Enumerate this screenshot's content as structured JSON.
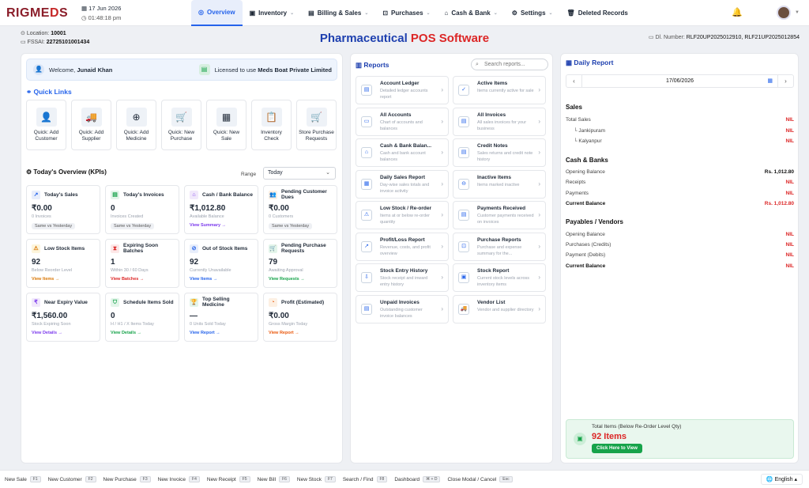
{
  "brand": {
    "logo_a": "RIGME",
    "logo_rx": "D",
    "logo_b": "S"
  },
  "header": {
    "date": "17 Jun 2026",
    "time": "01:48:18 pm",
    "bell_icon": "bell-icon",
    "user_icon": "user-avatar"
  },
  "nav": [
    {
      "label": "Overview",
      "icon": "◎",
      "active": true,
      "dropdown": false
    },
    {
      "label": "Inventory",
      "icon": "▣",
      "dropdown": true
    },
    {
      "label": "Billing & Sales",
      "icon": "▤",
      "dropdown": true
    },
    {
      "label": "Purchases",
      "icon": "⊡",
      "dropdown": true
    },
    {
      "label": "Cash & Bank",
      "icon": "⌂",
      "dropdown": true
    },
    {
      "label": "Settings",
      "icon": "⚙",
      "dropdown": true
    },
    {
      "label": "Deleted Records",
      "icon": "🗑",
      "dropdown": false
    }
  ],
  "location": {
    "location_label": "Location:",
    "location_value": "10001",
    "fssai_label": "FSSAI:",
    "fssai_value": "22725101001434"
  },
  "title": {
    "part1": "Pharmaceutical",
    "part2": "POS Software"
  },
  "dl": {
    "label": "Dl. Number:",
    "value": "RLF20UP2025012910, RLF21UP2025012854"
  },
  "welcome": {
    "prefix": "Welcome,",
    "name": "Junaid Khan",
    "licensed_prefix": "Licensed to use",
    "company": "Meds Boat Private Limited"
  },
  "quick_links": {
    "title": "Quick Links",
    "items": [
      {
        "label": "Quick: Add Customer",
        "icon": "👤",
        "name": "customer-icon"
      },
      {
        "label": "Quick: Add Supplier",
        "icon": "🚚",
        "name": "truck-icon"
      },
      {
        "label": "Quick: Add Medicine",
        "icon": "⊕",
        "name": "medicine-icon"
      },
      {
        "label": "Quick: New Purchase",
        "icon": "🛒",
        "name": "cart-icon"
      },
      {
        "label": "Quick: New Sale",
        "icon": "▦",
        "name": "sale-icon"
      },
      {
        "label": "Inventory Check",
        "icon": "📋",
        "name": "clipboard-icon"
      },
      {
        "label": "Store Purchase Requests",
        "icon": "🛒",
        "name": "store-cart-icon"
      }
    ]
  },
  "kpi": {
    "title": "Today's Overview (KPIs)",
    "range_label": "Range",
    "range_value": "Today",
    "cards": [
      {
        "title": "Today's Sales",
        "value": "₹0.00",
        "sub": "0 Invoices",
        "badge": "Same vs Yesterday",
        "link": "",
        "icon": "↗",
        "icon_bg": "#e8eefb",
        "icon_fg": "#2563eb",
        "link_color": "#2563eb"
      },
      {
        "title": "Today's Invoices",
        "value": "0",
        "sub": "Invoices Created",
        "badge": "Same vs Yesterday",
        "link": "",
        "icon": "▤",
        "icon_bg": "#e3f5ea",
        "icon_fg": "#16a34a",
        "link_color": "#16a34a"
      },
      {
        "title": "Cash / Bank Balance",
        "value": "₹1,012.80",
        "sub": "Available Balance",
        "badge": "",
        "link": "View Summary →",
        "icon": "⌂",
        "icon_bg": "#f1e8fb",
        "icon_fg": "#7c3aed",
        "link_color": "#7c3aed"
      },
      {
        "title": "Pending Customer Dues",
        "value": "₹0.00",
        "sub": "0 Customers",
        "badge": "Same vs Yesterday",
        "link": "",
        "icon": "👥",
        "icon_bg": "#fdf0e3",
        "icon_fg": "#ea580c",
        "link_color": "#ea580c"
      },
      {
        "title": "Low Stock Items",
        "value": "92",
        "sub": "Below Reorder Level",
        "badge": "",
        "link": "View Items →",
        "icon": "⚠",
        "icon_bg": "#fdf5dc",
        "icon_fg": "#d97706",
        "link_color": "#d97706"
      },
      {
        "title": "Expiring Soon Batches",
        "value": "1",
        "sub": "Within 30 / 60 Days",
        "badge": "",
        "link": "View Batches →",
        "icon": "⧗",
        "icon_bg": "#fde8e8",
        "icon_fg": "#dc2626",
        "link_color": "#dc2626"
      },
      {
        "title": "Out of Stock Items",
        "value": "92",
        "sub": "Currently Unavailable",
        "badge": "",
        "link": "View Items →",
        "icon": "⊘",
        "icon_bg": "#e8eefb",
        "icon_fg": "#2563eb",
        "link_color": "#2563eb"
      },
      {
        "title": "Pending Purchase Requests",
        "value": "79",
        "sub": "Awaiting Approval",
        "badge": "",
        "link": "View Requests →",
        "icon": "🛒",
        "icon_bg": "#e3f5ea",
        "icon_fg": "#16a34a",
        "link_color": "#16a34a"
      },
      {
        "title": "Near Expiry Value",
        "value": "₹1,560.00",
        "sub": "Stock Expiring Soon",
        "badge": "",
        "link": "View Details →",
        "icon": "₹",
        "icon_bg": "#f1e8fb",
        "icon_fg": "#7c3aed",
        "link_color": "#7c3aed"
      },
      {
        "title": "Schedule Items Sold",
        "value": "0",
        "sub": "H / H1 / X Items Today",
        "badge": "",
        "link": "View Details →",
        "icon": "⛉",
        "icon_bg": "#e3f5ea",
        "icon_fg": "#16a34a",
        "link_color": "#16a34a"
      },
      {
        "title": "Top Selling Medicine",
        "value": "—",
        "sub": "0 Units Sold Today",
        "badge": "",
        "link": "View Report →",
        "icon": "🏆",
        "icon_bg": "#e3f5ea",
        "icon_fg": "#16a34a",
        "link_color": "#2563eb"
      },
      {
        "title": "Profit (Estimated)",
        "value": "₹0.00",
        "sub": "Gross Margin Today",
        "badge": "",
        "link": "View Report →",
        "icon": "◔",
        "icon_bg": "#fdf0e3",
        "icon_fg": "#ea580c",
        "link_color": "#ea580c"
      }
    ]
  },
  "reports": {
    "title": "Reports",
    "search_placeholder": "Search reports...",
    "items": [
      {
        "title": "Account Ledger",
        "desc": "Detailed ledger accounts report",
        "icon": "▤"
      },
      {
        "title": "Active Items",
        "desc": "Items currently active for sale",
        "icon": "✓"
      },
      {
        "title": "All Accounts",
        "desc": "Chart of accounts and balances",
        "icon": "▭"
      },
      {
        "title": "All Invoices",
        "desc": "All sales invoices for your business",
        "icon": "▤"
      },
      {
        "title": "Cash & Bank Balan...",
        "desc": "Cash and bank account balances",
        "icon": "⌂"
      },
      {
        "title": "Credit Notes",
        "desc": "Sales returns and credit note history",
        "icon": "▤"
      },
      {
        "title": "Daily Sales Report",
        "desc": "Day-wise sales totals and invoice activity",
        "icon": "▦"
      },
      {
        "title": "Inactive Items",
        "desc": "Items marked inactive",
        "icon": "⊖"
      },
      {
        "title": "Low Stock / Re-order",
        "desc": "Items at or below re-order quantity",
        "icon": "⚠"
      },
      {
        "title": "Payments Received",
        "desc": "Customer payments received on invoices",
        "icon": "▤"
      },
      {
        "title": "Profit/Loss Report",
        "desc": "Revenue, costs, and profit overview",
        "icon": "↗"
      },
      {
        "title": "Purchase Reports",
        "desc": "Purchase and expense summary for the...",
        "icon": "⊡"
      },
      {
        "title": "Stock Entry History",
        "desc": "Stock receipt and inward entry history",
        "icon": "⇩"
      },
      {
        "title": "Stock Report",
        "desc": "Current stock levels across inventory items",
        "icon": "▣"
      },
      {
        "title": "Unpaid Invoices",
        "desc": "Outstanding customer invoice balances",
        "icon": "▤"
      },
      {
        "title": "Vendor List",
        "desc": "Vendor and supplier directory",
        "icon": "🚚"
      }
    ]
  },
  "daily": {
    "title": "Daily Report",
    "date": "17/06/2026",
    "sales_title": "Sales",
    "sales_rows": [
      {
        "label": "Total Sales",
        "value": "NIL",
        "sub": false
      },
      {
        "label": "└ Jankipuram",
        "value": "NIL",
        "sub": true
      },
      {
        "label": "└ Kalyanpur",
        "value": "NIL",
        "sub": true
      }
    ],
    "cash_title": "Cash & Banks",
    "cash_rows": [
      {
        "label": "Opening Balance",
        "value": "Rs. 1,012.80",
        "bold": false,
        "dark": true
      },
      {
        "label": "Receipts",
        "value": "NIL",
        "bold": false,
        "dark": false
      },
      {
        "label": "Payments",
        "value": "NIL",
        "bold": false,
        "dark": false
      },
      {
        "label": "Current Balance",
        "value": "Rs. 1,012.80",
        "bold": true,
        "dark": false
      }
    ],
    "payables_title": "Payables / Vendors",
    "payables_rows": [
      {
        "label": "Opening Balance",
        "value": "NIL",
        "bold": false
      },
      {
        "label": "Purchases (Credits)",
        "value": "NIL",
        "bold": false
      },
      {
        "label": "Payment (Debits)",
        "value": "NIL",
        "bold": false
      },
      {
        "label": "Current Balance",
        "value": "NIL",
        "bold": true
      }
    ],
    "total_items_label": "Total Items (Below Re-Order Level Qty)",
    "total_items_value": "92 Items",
    "view_button": "Click Here to View"
  },
  "shortcuts": [
    {
      "label": "New Sale",
      "key": "F1"
    },
    {
      "label": "New Customer",
      "key": "F2"
    },
    {
      "label": "New Purchase",
      "key": "F3"
    },
    {
      "label": "New Invoice",
      "key": "F4"
    },
    {
      "label": "New Receipt",
      "key": "F5"
    },
    {
      "label": "New Bill",
      "key": "F6"
    },
    {
      "label": "New Stock",
      "key": "F7"
    },
    {
      "label": "Search / Find",
      "key": "F8"
    },
    {
      "label": "Dashboard",
      "key": "⌘ + D"
    },
    {
      "label": "Close Modal / Cancel",
      "key": "Esc"
    }
  ],
  "language": {
    "value": "English"
  }
}
